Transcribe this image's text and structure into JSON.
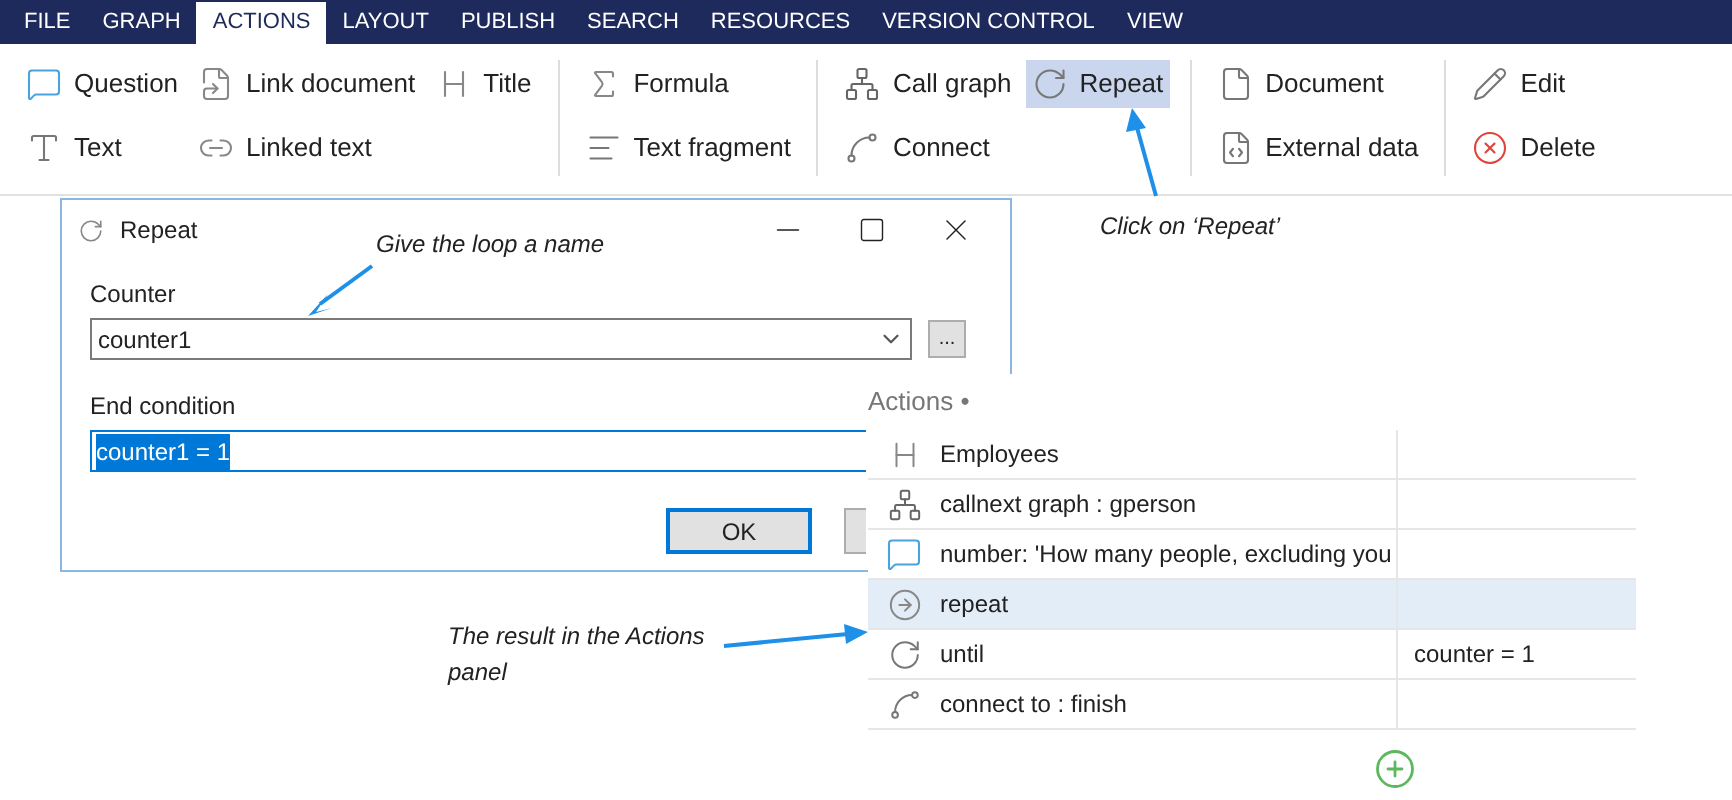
{
  "menu_tabs": [
    {
      "label": "FILE",
      "selected": false
    },
    {
      "label": "GRAPH",
      "selected": false
    },
    {
      "label": "ACTIONS",
      "selected": true
    },
    {
      "label": "LAYOUT",
      "selected": false
    },
    {
      "label": "PUBLISH",
      "selected": false
    },
    {
      "label": "SEARCH",
      "selected": false
    },
    {
      "label": "RESOURCES",
      "selected": false
    },
    {
      "label": "VERSION CONTROL",
      "selected": false
    },
    {
      "label": "VIEW",
      "selected": false
    }
  ],
  "ribbon_groups": [
    {
      "items": [
        {
          "kind": "question",
          "label": "Question",
          "selected": false
        },
        {
          "kind": "text",
          "label": "Text",
          "selected": false
        },
        {
          "kind": "link-document",
          "label": "Link document",
          "selected": false
        },
        {
          "kind": "link",
          "label": "Linked text",
          "selected": false
        },
        {
          "kind": "title",
          "label": "Title",
          "selected": false
        }
      ]
    },
    {
      "items": [
        {
          "kind": "formula",
          "label": "Formula",
          "selected": false
        },
        {
          "kind": "fragment",
          "label": "Text fragment",
          "selected": false
        }
      ]
    },
    {
      "items": [
        {
          "kind": "graph",
          "label": "Call graph",
          "selected": false
        },
        {
          "kind": "connect",
          "label": "Connect",
          "selected": false
        },
        {
          "kind": "repeat",
          "label": "Repeat",
          "selected": true
        }
      ]
    },
    {
      "items": [
        {
          "kind": "document",
          "label": "Document",
          "selected": false
        },
        {
          "kind": "xml",
          "label": "External data",
          "selected": false
        }
      ]
    },
    {
      "items": [
        {
          "kind": "edit",
          "label": "Edit",
          "selected": false
        },
        {
          "kind": "delete",
          "label": "Delete",
          "selected": false
        }
      ]
    }
  ],
  "dialog": {
    "title": "Repeat",
    "counter_label": "Counter",
    "counter_value": "counter1",
    "browse_button": "...",
    "end_label": "End condition",
    "end_value": "counter1 = 1",
    "end_value_selected": true,
    "ok_button": "OK"
  },
  "actions_panel": {
    "title": "Actions •",
    "rows": [
      {
        "kind": "title",
        "text": "Employees",
        "value": "",
        "selected": false
      },
      {
        "kind": "graph",
        "text": "callnext graph : gperson",
        "selected": false
      },
      {
        "kind": "question",
        "text": "number: 'How many people, excluding you",
        "selected": false
      },
      {
        "kind": "arrow",
        "text": "repeat",
        "selected": true
      },
      {
        "kind": "repeat",
        "text": "until",
        "value": "counter = 1",
        "selected": false
      },
      {
        "kind": "connect",
        "text": "connect to : finish",
        "selected": false
      }
    ]
  },
  "annotations": [
    {
      "text": "Give the loop a name"
    },
    {
      "text": "Click on ‘Repeat’"
    },
    {
      "text": "The result in the Actions panel"
    }
  ]
}
